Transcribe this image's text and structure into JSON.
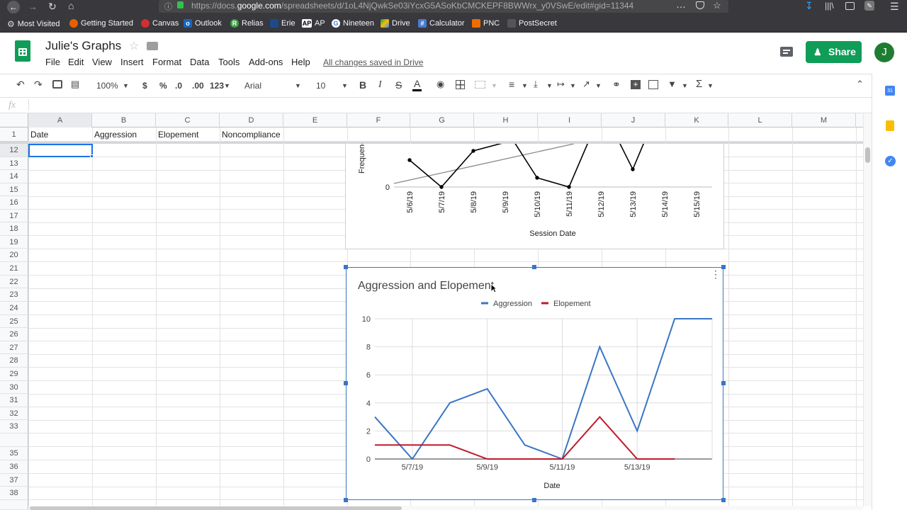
{
  "browser": {
    "url_prefix": "https://docs.",
    "url_domain": "google.com",
    "url_rest": "/spreadsheets/d/1oL4NjQwkSe03iYcxG5ASoKbCMCKEPF8BWWrx_y0VSwE/edit#gid=11344",
    "bookmarks": [
      "Most Visited",
      "Getting Started",
      "Canvas",
      "Outlook",
      "Relias",
      "Erie",
      "AP",
      "Nineteen",
      "Drive",
      "Calculator",
      "PNC",
      "PostSecret"
    ]
  },
  "doc": {
    "title": "Julie's Graphs",
    "save_status": "All changes saved in Drive",
    "share_label": "Share",
    "avatar_letter": "J",
    "menus": [
      "File",
      "Edit",
      "View",
      "Insert",
      "Format",
      "Data",
      "Tools",
      "Add-ons",
      "Help"
    ]
  },
  "toolbar": {
    "zoom": "100%",
    "currency": "$",
    "percent": "%",
    "dec_decrease": ".0",
    "dec_increase": ".00",
    "more_formats": "123",
    "font": "Arial",
    "font_size": "10",
    "bold": "B",
    "italic": "I",
    "strike": "S",
    "text_color": "A"
  },
  "formula_bar": {
    "fx": "fx",
    "value": ""
  },
  "grid": {
    "columns": [
      "A",
      "B",
      "C",
      "D",
      "E",
      "F",
      "G",
      "H",
      "I",
      "J",
      "K",
      "L",
      "M"
    ],
    "frozen_row_number": "1",
    "row_numbers": [
      "12",
      "13",
      "14",
      "15",
      "16",
      "17",
      "18",
      "19",
      "20",
      "21",
      "22",
      "23",
      "24",
      "25",
      "26",
      "27",
      "28",
      "29",
      "30",
      "31",
      "32",
      "33",
      "35",
      "36",
      "37",
      "38"
    ],
    "header_cells": [
      "Date",
      "Aggression",
      "Elopement",
      "Noncompliance"
    ]
  },
  "colors": {
    "green": "#0f9d58",
    "aggression": "#3a75c4",
    "elopement": "#c0192b"
  },
  "chart_data": [
    {
      "type": "line",
      "title": "",
      "xlabel": "Session Date",
      "ylabel": "Frequenc",
      "categories": [
        "5/6/19",
        "5/7/19",
        "5/8/19",
        "5/9/19",
        "5/10/19",
        "5/11/19",
        "5/12/19",
        "5/13/19",
        "5/14/19",
        "5/15/19"
      ],
      "y_tick_visible": "0",
      "partial_view": true
    },
    {
      "type": "line",
      "title": "Aggression and Elopement",
      "xlabel": "Date",
      "ylabel": "",
      "legend_position": "top",
      "ylim": [
        0,
        10
      ],
      "yticks": [
        "10",
        "8",
        "6",
        "4",
        "2",
        "0"
      ],
      "xtick_labels": [
        "5/7/19",
        "5/9/19",
        "5/11/19",
        "5/13/19"
      ],
      "x": [
        "5/6/19",
        "5/7/19",
        "5/8/19",
        "5/9/19",
        "5/10/19",
        "5/11/19",
        "5/12/19",
        "5/13/19",
        "5/14/19",
        "5/15/19"
      ],
      "series": [
        {
          "name": "Aggression",
          "color": "#3a75c4",
          "values": [
            3,
            0,
            4,
            5,
            1,
            0,
            8,
            2,
            10,
            10
          ]
        },
        {
          "name": "Elopement",
          "color": "#c0192b",
          "values": [
            1,
            1,
            1,
            0,
            0,
            0,
            3,
            0,
            0,
            null
          ]
        }
      ]
    }
  ]
}
